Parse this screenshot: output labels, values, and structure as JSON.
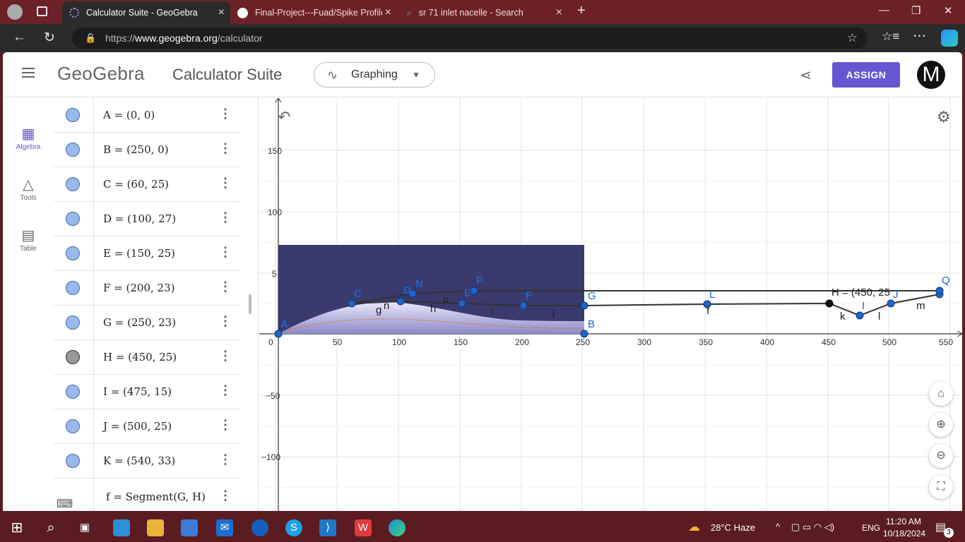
{
  "browser": {
    "tabs": [
      {
        "title": "Calculator Suite - GeoGebra"
      },
      {
        "title": "Final-Project---Fuad/Spike Profile"
      },
      {
        "title": "sr 71 inlet nacelle - Search"
      }
    ],
    "url_prefix": "https://",
    "url_host": "www.geogebra.org",
    "url_path": "/calculator"
  },
  "header": {
    "logo": "GeoGebra",
    "suite_title": "Calculator Suite",
    "app_picker": "Graphing",
    "assign_label": "ASSIGN",
    "avatar_letter": "M",
    "accent_color": "#6557d2"
  },
  "sidenav": {
    "items": [
      {
        "label": "Algebra",
        "icon": "calculator-icon"
      },
      {
        "label": "Tools",
        "icon": "shapes-icon"
      },
      {
        "label": "Table",
        "icon": "table-icon"
      }
    ]
  },
  "algebra": {
    "rows": [
      {
        "expr": "A = (0, 0)"
      },
      {
        "expr": "B = (250, 0)"
      },
      {
        "expr": "C = (60, 25)"
      },
      {
        "expr": "D = (100, 27)"
      },
      {
        "expr": "E = (150, 25)"
      },
      {
        "expr": "F = (200, 23)"
      },
      {
        "expr": "G = (250, 23)"
      },
      {
        "expr": "H = (450, 25)"
      },
      {
        "expr": "I = (475, 15)"
      },
      {
        "expr": "J = (500, 25)"
      },
      {
        "expr": "K = (540, 33)"
      },
      {
        "expr": "f = Segment(G, H)"
      }
    ]
  },
  "graph": {
    "x_ticks": [
      "0",
      "50",
      "100",
      "150",
      "200",
      "250",
      "300",
      "350",
      "400",
      "450",
      "500",
      "550"
    ],
    "y_ticks": [
      "150",
      "100",
      "5",
      "−50",
      "−100"
    ],
    "point_labels": [
      "A",
      "B",
      "C",
      "D",
      "E",
      "F",
      "G",
      "N",
      "P",
      "Q",
      "L",
      "I",
      "J"
    ],
    "segment_labels": [
      "g",
      "n",
      "h",
      "p",
      "i",
      "j",
      "f",
      "k",
      "l",
      "m"
    ],
    "caption_h": "H = (450, 25"
  },
  "taskbar": {
    "weather": "28°C  Haze",
    "lang": "ENG",
    "time": "11:20 AM",
    "date": "10/18/2024",
    "notif_count": "3"
  }
}
